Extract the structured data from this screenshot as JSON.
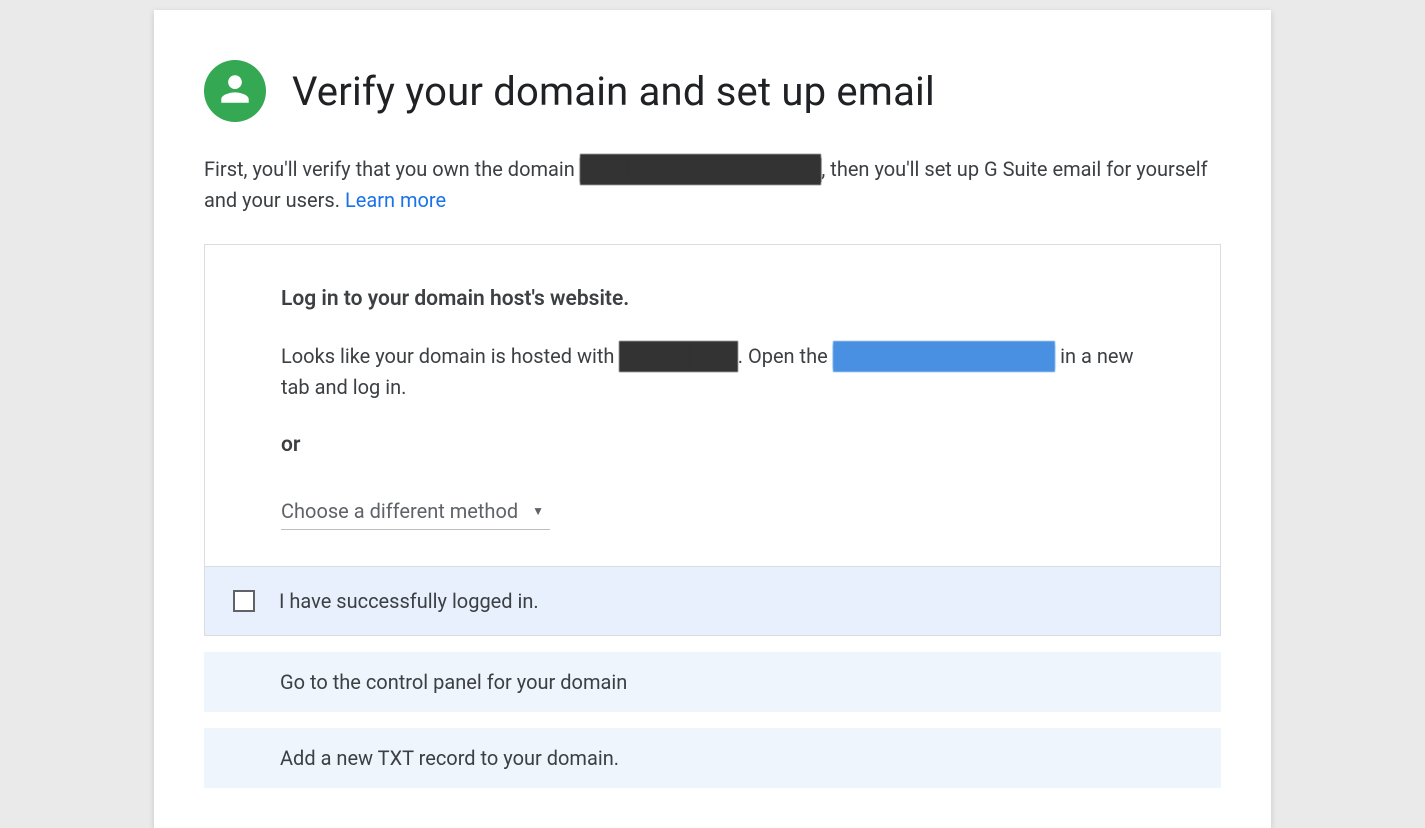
{
  "header": {
    "title": "Verify your domain and set up email"
  },
  "intro": {
    "text_before_domain": "First, you'll verify that you own the domain ",
    "domain_masked": "██ ███ ██████ █████",
    "text_after_domain": ", then you'll set up G Suite email for yourself and your users. ",
    "learn_more": "Learn more"
  },
  "step": {
    "heading": "Log in to your domain host's website.",
    "text_before_host": "Looks like your domain is hosted with ",
    "host_masked": "██████ ██",
    "text_mid": ". Open the ",
    "host_link_masked": "██████ ███████ ██",
    "text_after": " in a new tab and log in.",
    "or_label": "or",
    "method_select_label": "Choose a different method"
  },
  "confirm": {
    "label": "I have successfully logged in."
  },
  "substeps": [
    {
      "label": "Go to the control panel for your domain"
    },
    {
      "label": "Add a new TXT record to your domain."
    }
  ]
}
